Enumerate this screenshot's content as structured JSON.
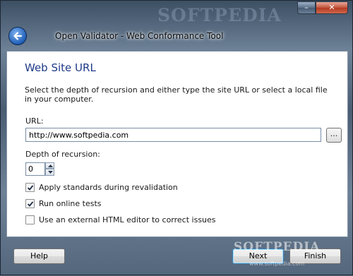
{
  "window": {
    "title": "Open Validator - Web Conformance Tool",
    "watermark": "SOFTPEDIA",
    "minimize_glyph": "–",
    "close_glyph": "✕"
  },
  "page": {
    "title": "Web Site URL",
    "description": "Select the depth of recursion and either type the site URL or select a local file in your computer."
  },
  "url": {
    "label": "URL:",
    "value": "http://www.softpedia.com",
    "browse_label": "..."
  },
  "depth": {
    "label": "Depth of recursion:",
    "value": "0"
  },
  "options": [
    {
      "label": "Apply standards during revalidation",
      "checked": true
    },
    {
      "label": "Run online tests",
      "checked": true
    },
    {
      "label": "Use an external HTML editor to correct issues",
      "checked": false
    }
  ],
  "footer": {
    "help_label": "Help",
    "next_label": "Next",
    "finish_label": "Finish",
    "watermark": "SOFTPEDIA",
    "watermark_small": "www.softpedia.com"
  },
  "icons": {
    "back": "back-arrow-icon",
    "spin_up": "chevron-up-icon",
    "spin_down": "chevron-down-icon",
    "check": "checkmark-icon"
  },
  "colors": {
    "title_blue": "#1e3a8a",
    "frame": "#5e7288",
    "close_red": "#c2543b"
  }
}
